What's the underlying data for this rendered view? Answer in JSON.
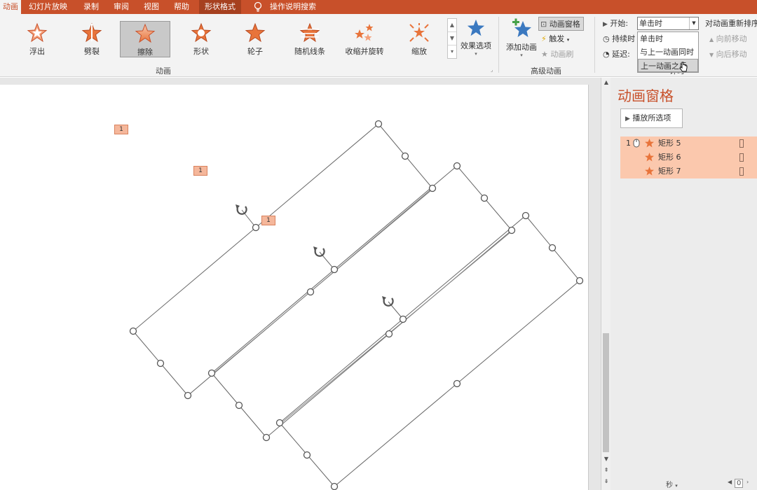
{
  "tabs": [
    "动画",
    "幻灯片放映",
    "录制",
    "审阅",
    "视图",
    "帮助",
    "形状格式"
  ],
  "tab_search": "操作说明搜索",
  "gallery": [
    {
      "label": "浮出"
    },
    {
      "label": "劈裂"
    },
    {
      "label": "擦除"
    },
    {
      "label": "形状"
    },
    {
      "label": "轮子"
    },
    {
      "label": "随机线条"
    },
    {
      "label": "收缩并旋转"
    },
    {
      "label": "缩放"
    }
  ],
  "effect_options": "效果选项",
  "group_animation": "动画",
  "add_animation": "添加动画",
  "animation_pane_btn": "动画窗格",
  "trigger": "触发",
  "animation_painter": "动画刷",
  "group_advanced": "高级动画",
  "timing": {
    "start_label": "开始:",
    "start_value": "单击时",
    "duration_label": "持续时",
    "delay_label": "延迟:",
    "reorder_label": "对动画重新排序",
    "move_earlier": "向前移动",
    "move_later": "向后移动",
    "group_label": "计时"
  },
  "start_options": [
    "单击时",
    "与上一动画同时",
    "上一动画之后"
  ],
  "slide_tags": [
    "1",
    "1",
    "1"
  ],
  "pane": {
    "title": "动画窗格",
    "play_label": "播放所选项",
    "items": [
      {
        "num": "1",
        "name": "矩形 5"
      },
      {
        "num": "",
        "name": "矩形 6"
      },
      {
        "num": "",
        "name": "矩形 7"
      }
    ],
    "seconds_label": "秒",
    "page_value": "0"
  },
  "colors": {
    "accent": "#c8502a",
    "star_orange": "#e8743b",
    "star_blue": "#3b79c0",
    "selection_bg": "#fbc8ad"
  }
}
